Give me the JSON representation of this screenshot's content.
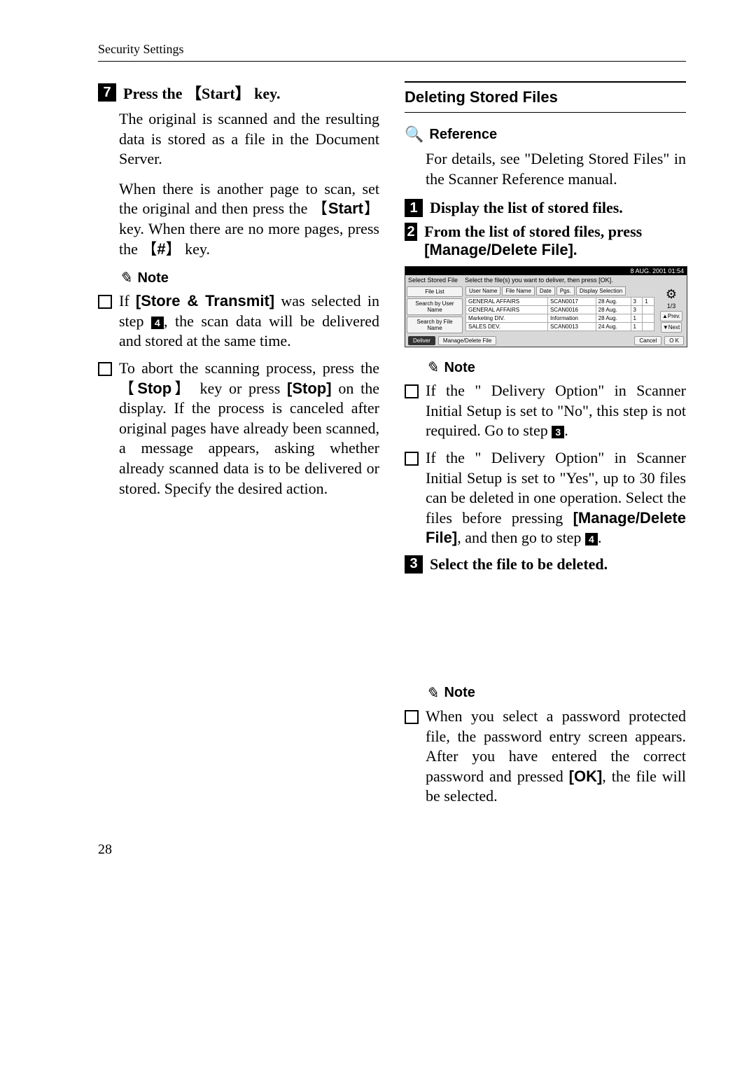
{
  "header": "Security Settings",
  "left": {
    "step7": {
      "num": "7",
      "text": "Press the 【Start】 key."
    },
    "p1": "The original is scanned and the resulting data is stored as a file in the Document Server.",
    "p2a": "When there is another page to scan, set the original and then press the ",
    "p2_key1": "Start",
    "p2b": " key. When there are no more pages, press the ",
    "p2_key2": "#",
    "p2c": " key.",
    "noteLabel": "Note",
    "li1a": "If ",
    "li1_bold": "[Store & Transmit]",
    "li1b": " was selected in step ",
    "li1_badge": "4",
    "li1c": ", the scan data will be delivered and stored at the same time.",
    "li2a": "To abort the scanning process, press the ",
    "li2_key": "Stop",
    "li2b": " key or press ",
    "li2_bold": "[Stop]",
    "li2c": " on the display. If the process is canceled after original pages have already been scanned, a message appears, asking whether already scanned data is to be delivered or stored. Specify the desired action."
  },
  "right": {
    "heading": "Deleting Stored Files",
    "referenceLabel": "Reference",
    "refText": "For details, see \"Deleting Stored Files\" in the Scanner Reference manual.",
    "step1": {
      "num": "1",
      "text": "Display the list of stored files."
    },
    "step2": {
      "num": "2",
      "textA": "From the list of stored files, press ",
      "bold": "[Manage/Delete File]",
      "textB": "."
    },
    "noteLabel": "Note",
    "opt1a": "If the \" Delivery Option\" in Scanner Initial Setup is set to \"No\", this step is not required. Go to step ",
    "opt1_badge": "3",
    "opt1b": ".",
    "opt2a": "If the \" Delivery Option\" in Scanner Initial Setup is set to \"Yes\", up to 30 files can be deleted in one operation. Select the files before pressing ",
    "opt2_bold": "[Manage/Delete File]",
    "opt2b": ", and then go to step ",
    "opt2_badge": "4",
    "opt2c": ".",
    "step3": {
      "num": "3",
      "text": "Select the file to be deleted."
    },
    "note2a": "When you select a password protected file, the password entry screen appears. After you have entered the correct password and pressed ",
    "note2_bold": "[OK]",
    "note2b": ", the file will be selected."
  },
  "screenshot": {
    "title": "8 AUG.  2001  01:54",
    "header_left": "Select Stored File",
    "header_right": "Select the file(s) you want to deliver, then press [OK].",
    "leftBtns": [
      "File List",
      "Search by User Name",
      "Search by File Name"
    ],
    "tabs": [
      "User Name",
      "File Name",
      "Date",
      "Pgs.",
      "Display Selection"
    ],
    "rows": [
      [
        "GENERAL AFFAIRS",
        "SCAN0017",
        "28 Aug.",
        "3",
        "1"
      ],
      [
        "GENERAL AFFAIRS",
        "SCAN0016",
        "28 Aug.",
        "3",
        ""
      ],
      [
        "Marketing DIV.",
        "Information",
        "28 Aug.",
        "1",
        ""
      ],
      [
        "SALES DEV.",
        "SCAN0013",
        "24 Aug.",
        "1",
        ""
      ]
    ],
    "pager": "1/3",
    "prev": "▲Prev.",
    "next": "▼Next",
    "deliver": "Deliver",
    "manage": "Manage/Delete File",
    "cancel": "Cancel",
    "ok": "O K"
  },
  "pageNumber": "28"
}
